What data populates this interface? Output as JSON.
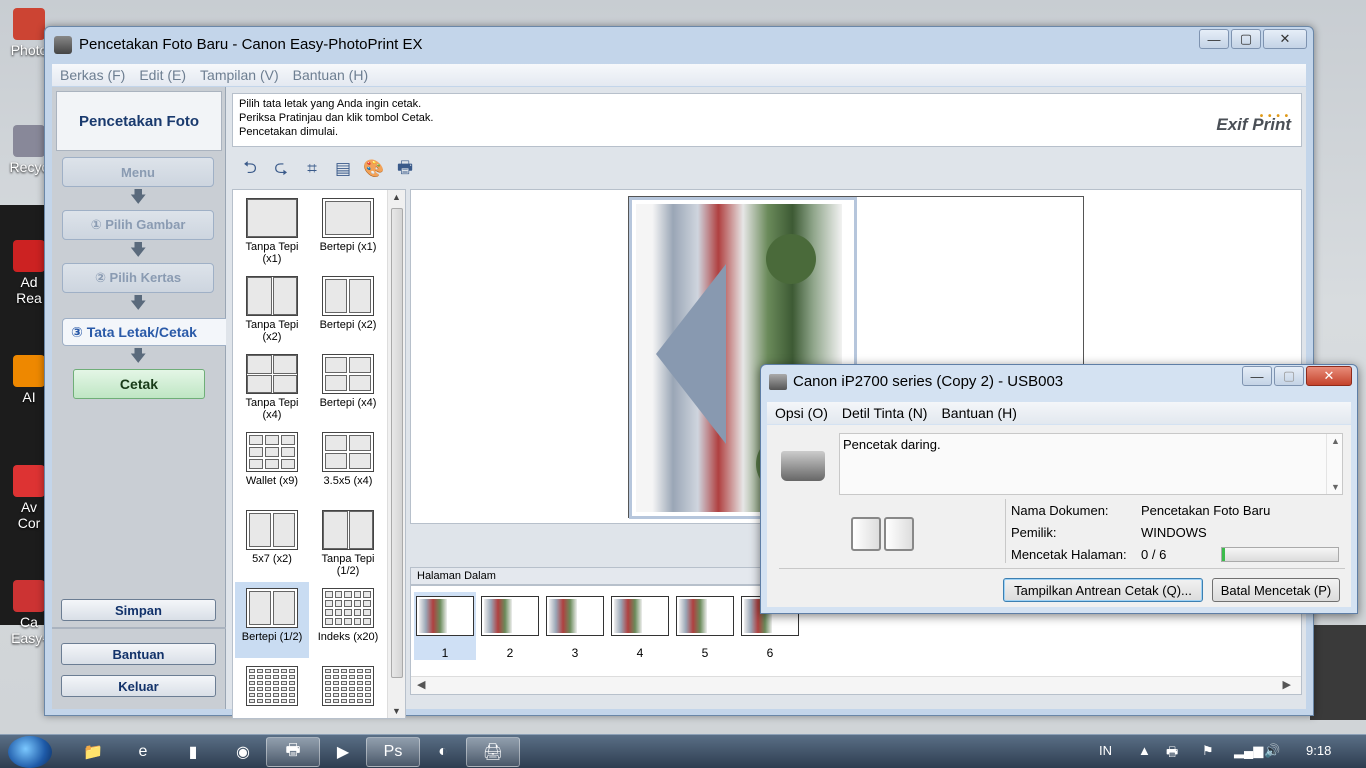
{
  "desktop": {
    "icons": [
      {
        "label": "Photo",
        "color": "#c43"
      },
      {
        "label": "Recyc",
        "color": "#889"
      },
      {
        "label": "Ad\nRea",
        "color": "#c22"
      },
      {
        "label": "AI",
        "color": "#e80"
      },
      {
        "label": "Av\nCor",
        "color": "#d33"
      },
      {
        "label": "Ca\nEasy-",
        "color": "#c33"
      }
    ]
  },
  "main_window": {
    "title": "Pencetakan Foto Baru - Canon Easy-PhotoPrint EX",
    "controls": {
      "minimize": "—",
      "maximize": "▢",
      "close": "✕"
    },
    "menu": [
      "Berkas (F)",
      "Edit (E)",
      "Tampilan (V)",
      "Bantuan (H)"
    ],
    "left_panel": {
      "header": "Pencetakan Foto",
      "steps": [
        "Menu",
        "① Pilih Gambar",
        "② Pilih Kertas",
        "③ Tata Letak/Cetak"
      ],
      "arrow": "🡇",
      "print_button": "Cetak",
      "save_button": "Simpan",
      "help_button": "Bantuan",
      "exit_button": "Keluar"
    },
    "instructions": [
      "Pilih tata letak yang Anda ingin cetak.",
      "Periksa Pratinjau dan klik tombol Cetak.",
      "Pencetakan dimulai."
    ],
    "logo": "Exif Print",
    "toolbar_icons": [
      "rotate-left-icon",
      "rotate-right-icon",
      "crop-icon",
      "date-icon",
      "correction-icon",
      "print-settings-icon"
    ],
    "toolbar_glyphs": [
      "⮌",
      "⮎",
      "⌗",
      "▤",
      "🎨",
      "🖶"
    ],
    "layouts": [
      {
        "label": "Tanpa Tepi (x1)",
        "grid": [
          1,
          1
        ],
        "borderless": true
      },
      {
        "label": "Bertepi (x1)",
        "grid": [
          1,
          1
        ],
        "borderless": false
      },
      {
        "label": "Tanpa Tepi (x2)",
        "grid": [
          2,
          1
        ],
        "borderless": true
      },
      {
        "label": "Bertepi (x2)",
        "grid": [
          2,
          1
        ],
        "borderless": false
      },
      {
        "label": "Tanpa Tepi (x4)",
        "grid": [
          2,
          2
        ],
        "borderless": true
      },
      {
        "label": "Bertepi (x4)",
        "grid": [
          2,
          2
        ],
        "borderless": false
      },
      {
        "label": "Wallet (x9)",
        "grid": [
          3,
          3
        ],
        "borderless": false
      },
      {
        "label": "3.5x5 (x4)",
        "grid": [
          2,
          2
        ],
        "borderless": false
      },
      {
        "label": "5x7 (x2)",
        "grid": [
          2,
          1
        ],
        "borderless": false
      },
      {
        "label": "Tanpa Tepi (1/2)",
        "grid": [
          2,
          1
        ],
        "borderless": true
      },
      {
        "label": "Bertepi (1/2)",
        "grid": [
          2,
          1
        ],
        "borderless": false,
        "selected": true
      },
      {
        "label": "Indeks (x20)",
        "grid": [
          5,
          4
        ],
        "borderless": false
      },
      {
        "label": "",
        "grid": [
          6,
          6
        ],
        "borderless": false
      },
      {
        "label": "",
        "grid": [
          6,
          6
        ],
        "borderless": false
      }
    ],
    "pages_title": "Halaman Dalam",
    "pages": [
      "1",
      "2",
      "3",
      "4",
      "5",
      "6"
    ],
    "selected_page": "1"
  },
  "printer_dialog": {
    "title": "Canon iP2700 series (Copy 2) - USB003",
    "menu": [
      "Opsi (O)",
      "Detil Tinta (N)",
      "Bantuan (H)"
    ],
    "status": "Pencetak daring.",
    "fields": [
      {
        "label": "Nama Dokumen:",
        "value": "Pencetakan Foto Baru"
      },
      {
        "label": "Pemilik:",
        "value": "WINDOWS"
      },
      {
        "label": "Mencetak Halaman:",
        "value": "0 / 6"
      }
    ],
    "progress": 0.03,
    "buttons": {
      "queue": "Tampilkan Antrean Cetak (Q)...",
      "cancel": "Batal Mencetak (P)"
    }
  },
  "taskbar": {
    "apps": [
      {
        "name": "explorer-icon",
        "glyph": "📁",
        "open": false
      },
      {
        "name": "ie-icon",
        "glyph": "e",
        "open": false
      },
      {
        "name": "app-icon",
        "glyph": "▮",
        "open": false
      },
      {
        "name": "chrome-icon",
        "glyph": "◉",
        "open": false
      },
      {
        "name": "printer-app-icon",
        "glyph": "🖶",
        "open": true
      },
      {
        "name": "media-icon",
        "glyph": "▶",
        "open": false
      },
      {
        "name": "photoshop-icon",
        "glyph": "Ps",
        "open": true
      },
      {
        "name": "firefox-icon",
        "glyph": "◐",
        "open": false
      },
      {
        "name": "easyphotoprint-icon",
        "glyph": "🖨",
        "open": true
      }
    ],
    "lang": "IN",
    "time": "9:18"
  }
}
